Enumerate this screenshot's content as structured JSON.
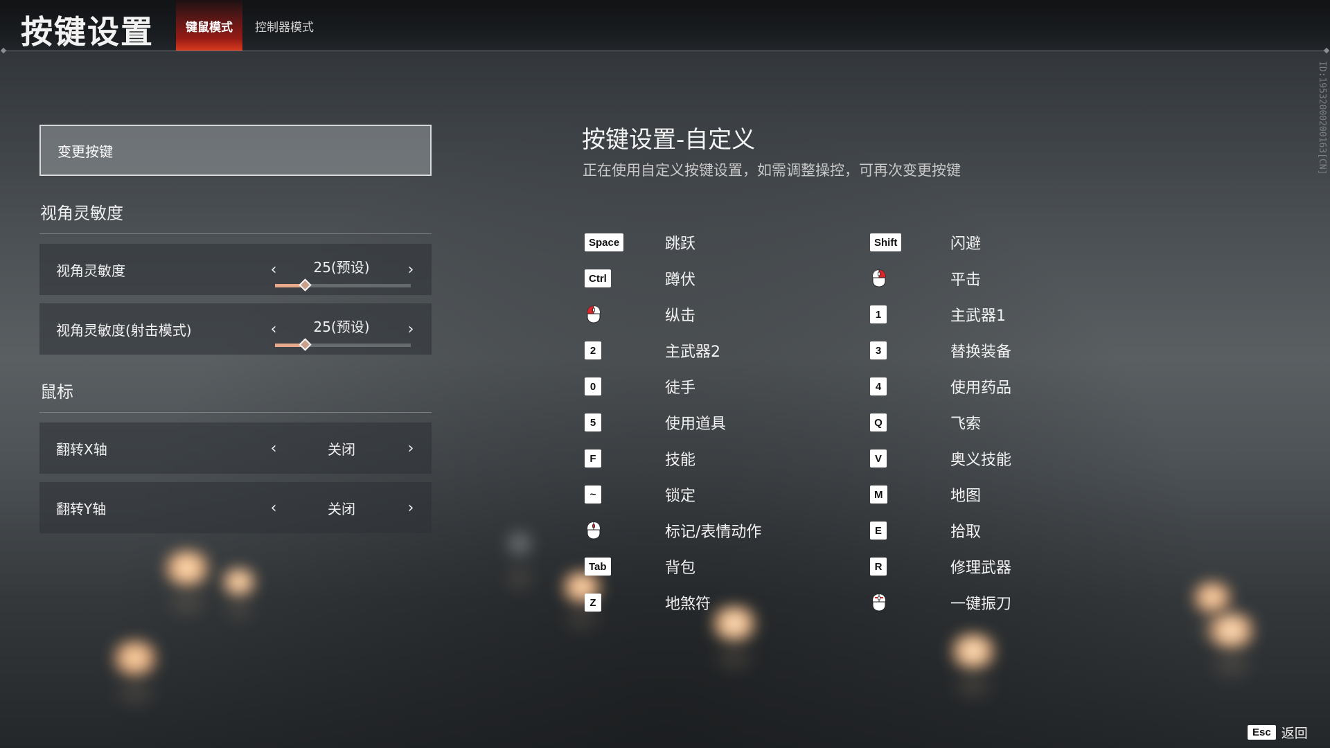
{
  "header": {
    "title": "按键设置",
    "tabs": [
      {
        "label": "键鼠模式",
        "active": true
      },
      {
        "label": "控制器模式",
        "active": false
      }
    ]
  },
  "build_id": "ID:19532000200163[CN]",
  "left_panel": {
    "change_keys_label": "变更按键",
    "sections": [
      {
        "title": "视角灵敏度",
        "rows": [
          {
            "label": "视角灵敏度",
            "value": "25(预设)",
            "slider_fraction": 0.22
          },
          {
            "label": "视角灵敏度(射击模式)",
            "value": "25(预设)",
            "slider_fraction": 0.22
          }
        ]
      },
      {
        "title": "鼠标",
        "rows": [
          {
            "label": "翻转X轴",
            "value": "关闭"
          },
          {
            "label": "翻转Y轴",
            "value": "关闭"
          }
        ]
      }
    ],
    "arrow_left": "‹",
    "arrow_right": "›"
  },
  "right_panel": {
    "title": "按键设置-自定义",
    "subtitle": "正在使用自定义按键设置，如需调整操控，可再次变更按键",
    "bindings_left": [
      {
        "key": "Space",
        "action": "跳跃"
      },
      {
        "key": "Ctrl",
        "action": "蹲伏"
      },
      {
        "key": "",
        "icon": "mouse-left-click-icon",
        "action": "纵击"
      },
      {
        "key": "2",
        "action": "主武器2"
      },
      {
        "key": "0",
        "action": "徒手"
      },
      {
        "key": "5",
        "action": "使用道具"
      },
      {
        "key": "F",
        "action": "技能"
      },
      {
        "key": "~",
        "action": "锁定"
      },
      {
        "key": "",
        "icon": "mouse-middle-click-icon",
        "action": "标记/表情动作"
      },
      {
        "key": "Tab",
        "action": "背包"
      },
      {
        "key": "Z",
        "action": "地煞符"
      }
    ],
    "bindings_right": [
      {
        "key": "Shift",
        "action": "闪避"
      },
      {
        "key": "",
        "icon": "mouse-right-click-icon",
        "action": "平击"
      },
      {
        "key": "1",
        "action": "主武器1"
      },
      {
        "key": "3",
        "action": "替换装备"
      },
      {
        "key": "4",
        "action": "使用药品"
      },
      {
        "key": "Q",
        "action": "飞索"
      },
      {
        "key": "V",
        "action": "奥义技能"
      },
      {
        "key": "M",
        "action": "地图"
      },
      {
        "key": "E",
        "action": "拾取"
      },
      {
        "key": "R",
        "action": "修理武器"
      },
      {
        "key": "",
        "icon": "mouse-both-click-icon",
        "action": "一键振刀"
      }
    ]
  },
  "footer": {
    "esc_key": "Esc",
    "esc_label": "返回"
  },
  "colors": {
    "accent_tab": "#c8201a",
    "slider_fill": "#e8a98a",
    "mouse_click": "#d8262a"
  }
}
